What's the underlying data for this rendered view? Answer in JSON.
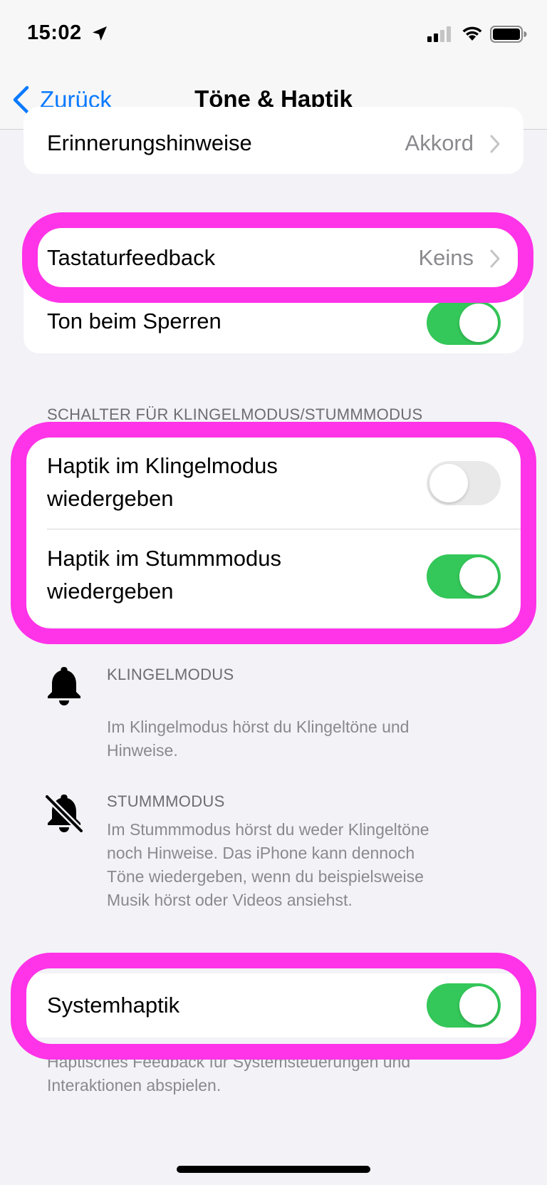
{
  "status_bar": {
    "time": "15:02"
  },
  "nav": {
    "back_label": "Zurück",
    "title": "Töne & Haptik"
  },
  "rows": {
    "reminder": {
      "label": "Erinnerungshinweise",
      "value": "Akkord"
    },
    "keyboard": {
      "label": "Tastaturfeedback",
      "value": "Keins"
    },
    "lock_sound": {
      "label": "Ton beim Sperren",
      "on": true
    }
  },
  "switch_section": {
    "header": "SCHALTER FÜR KLINGELMODUS/STUMMMODUS",
    "haptic_ring": {
      "label_line1": "Haptik im Klingelmodus",
      "label_line2": "wiedergeben",
      "on": false
    },
    "haptic_silent": {
      "label_line1": "Haptik im Stummmodus",
      "label_line2": "wiedergeben",
      "on": true
    }
  },
  "info": {
    "ring": {
      "title": "KLINGELMODUS",
      "line1": "Im Klingelmodus hörst du Klingeltöne und",
      "line2": "Hinweise."
    },
    "silent": {
      "title": "STUMMMODUS",
      "line1": "Im Stummmodus hörst du weder Klingeltöne",
      "line2": "noch Hinweise. Das iPhone kann dennoch",
      "line3": "Töne wiedergeben, wenn du beispielsweise",
      "line4": "Musik hörst oder Videos ansiehst."
    }
  },
  "system_haptics": {
    "label": "Systemhaptik",
    "on": true,
    "footer_line1": "Haptisches Feedback für Systemsteuerungen und",
    "footer_line2": "Interaktionen abspielen."
  },
  "colors": {
    "accent": "#0a7aff",
    "toggle_on": "#34c759",
    "highlight": "#ff33e7"
  }
}
